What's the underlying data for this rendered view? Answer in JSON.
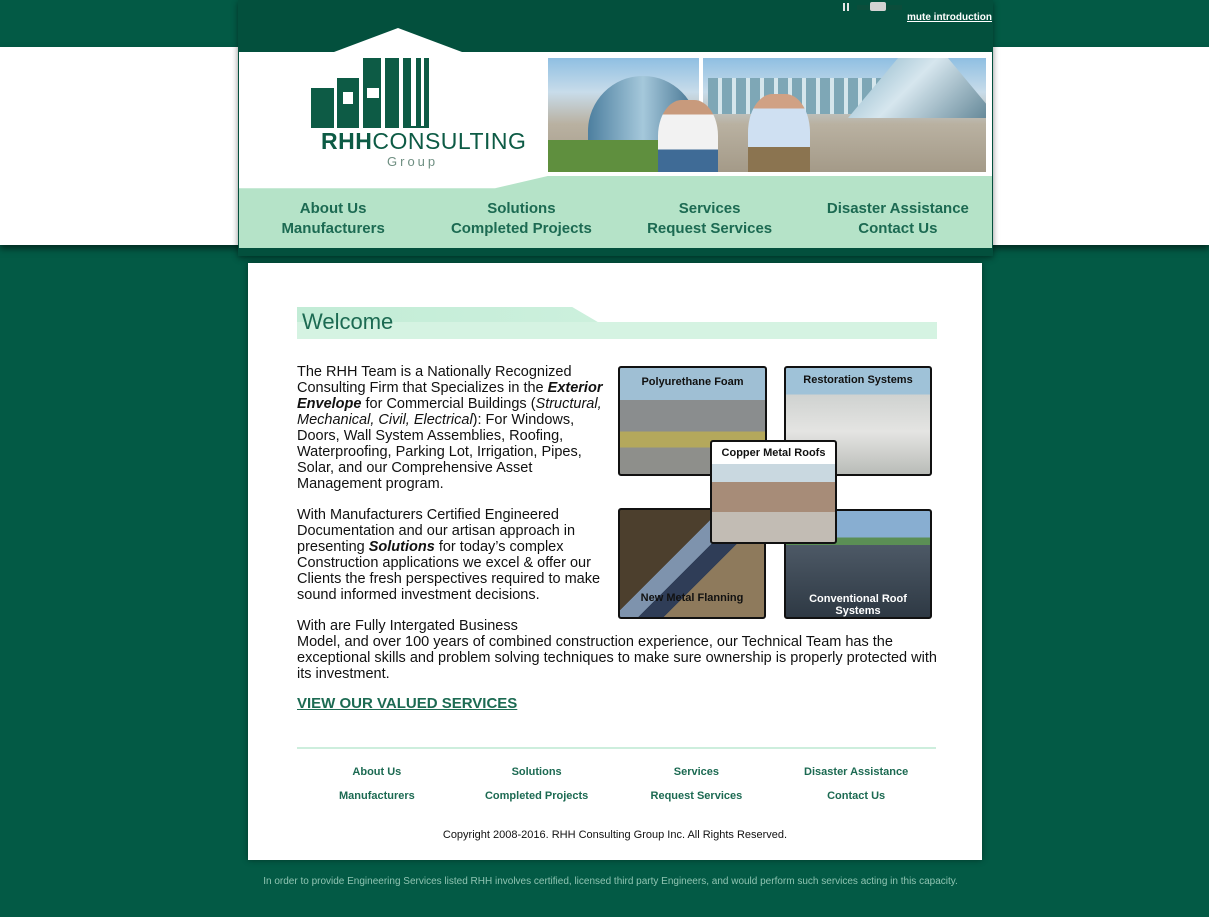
{
  "media": {
    "mute_label": "mute introduction"
  },
  "logo": {
    "bold": "RHH",
    "light": "CONSULTING",
    "sub": "Group"
  },
  "nav": {
    "row1": [
      "About Us",
      "Solutions",
      "Services",
      "Disaster Assistance"
    ],
    "row2": [
      "Manufacturers",
      "Completed Projects",
      "Request Services",
      "Contact Us"
    ]
  },
  "welcome": {
    "title": "Welcome"
  },
  "body": {
    "p1_a": "The RHH Team is a Nationally Recognized Consulting Firm that Specializes in the ",
    "p1_em": "Exterior Envelope",
    "p1_b": " for Commercial Buildings (",
    "p1_it": "Structural, Mechanical, Civil, Electrical",
    "p1_c": "): For Windows, Doors, Wall System Assemblies, Roofing, Waterproofing, Parking Lot, Irrigation, Pipes, Solar, and our Comprehensive Asset Management program.",
    "p2_a": "With Manufacturers Certified Engineered Documentation and our artisan approach in presenting ",
    "p2_em": "Solutions",
    "p2_b": " for today’s complex Construction applications we excel & offer our Clients the fresh perspectives required to make sound informed investment decisions.",
    "p3_a": "With are Fully Intergated Business",
    "p3_b": "Model, and over 100 years of combined construction experience, our Technical Team has the exceptional skills and problem solving techniques to make sure ownership is properly protected with its investment."
  },
  "services_link": "VIEW OUR VALUED SERVICES",
  "tiles": {
    "foam": "Polyurethane Foam",
    "restoration": "Restoration Systems",
    "copper": "Copper Metal Roofs",
    "metal": "New Metal  Flanning",
    "conventional": "Conventional Roof Systems"
  },
  "footer_nav": {
    "row1": [
      "About Us",
      "Solutions",
      "Services",
      "Disaster Assistance"
    ],
    "row2": [
      "Manufacturers",
      "Completed Projects",
      "Request Services",
      "Contact Us"
    ]
  },
  "copyright": "Copyright 2008-2016. RHH Consulting Group Inc. All Rights Reserved.",
  "disclaimer": "In order to provide Engineering Services listed RHH involves certified, licensed third party Engineers, and would perform such services acting in this capacity."
}
